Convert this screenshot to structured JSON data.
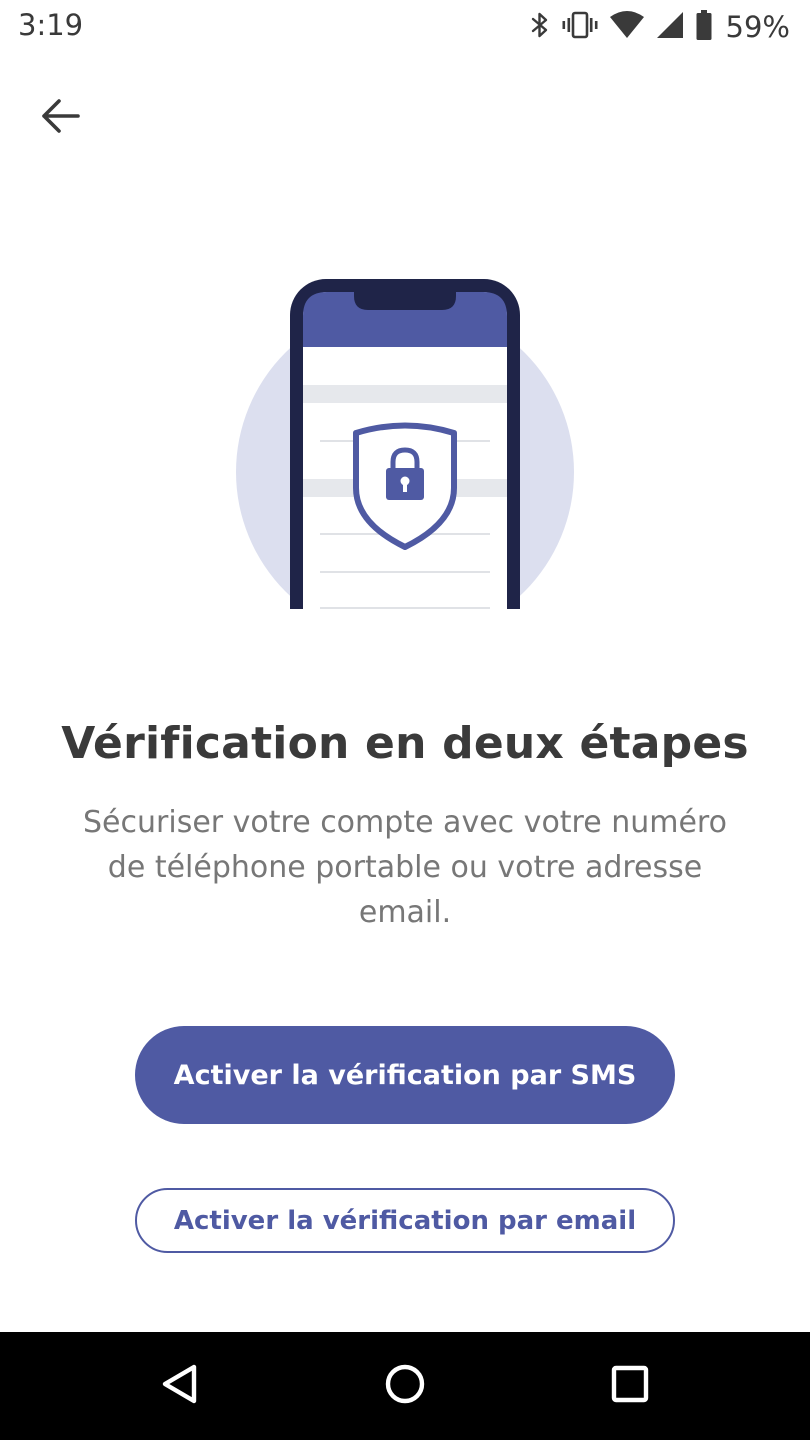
{
  "status_bar": {
    "time": "3:19",
    "battery_percent": "59%",
    "icons": [
      "bluetooth-icon",
      "vibrate-icon",
      "wifi-icon",
      "cell-signal-icon",
      "battery-icon"
    ]
  },
  "header": {
    "back_icon": "arrow-left-icon"
  },
  "illustration": {
    "icon": "phone-shield-lock-illustration",
    "colors": {
      "circle": "#dcdfef",
      "phone_frame": "#1f2448",
      "screen_header": "#4f5aa3",
      "shield": "#4f5aa3"
    }
  },
  "main": {
    "title": "Vérification en deux étapes",
    "description": "Sécuriser votre compte avec votre numéro de téléphone portable ou votre adresse email."
  },
  "actions": {
    "sms_button_label": "Activer la vérification par SMS",
    "email_button_label": "Activer la vérification par email"
  },
  "nav_bar": {
    "back_icon": "nav-back-icon",
    "home_icon": "nav-home-icon",
    "recents_icon": "nav-recents-icon"
  },
  "colors": {
    "accent": "#4f5aa3",
    "title_text": "#3a3a3a",
    "body_text": "#777777"
  }
}
